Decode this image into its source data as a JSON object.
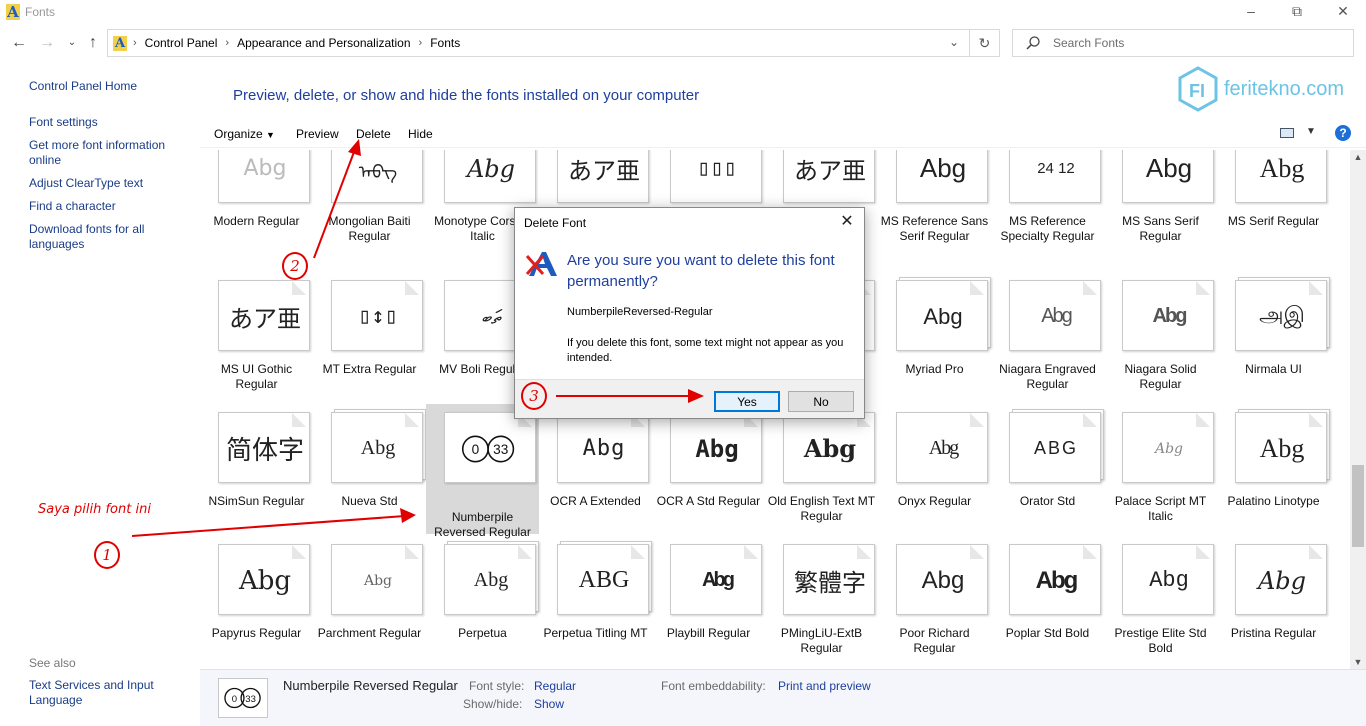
{
  "window": {
    "title": "Fonts",
    "app_icon_letter": "A"
  },
  "address_bar": {
    "crumbs": [
      "Control Panel",
      "Appearance and Personalization",
      "Fonts"
    ]
  },
  "search": {
    "placeholder": "Search Fonts"
  },
  "left_pane": {
    "links": [
      "Control Panel Home",
      "Font settings",
      "Get more font information online",
      "Adjust ClearType text",
      "Find a character",
      "Download fonts for all languages"
    ],
    "see_also_label": "See also",
    "see_also_links": [
      "Text Services and Input Language"
    ]
  },
  "header": {
    "heading": "Preview, delete, or show and hide the fonts installed on your computer"
  },
  "watermark": {
    "text": "feritekno.com"
  },
  "toolbar": {
    "organize": "Organize",
    "preview": "Preview",
    "delete": "Delete",
    "hide": "Hide",
    "help": "?"
  },
  "fonts": [
    {
      "name": "Modern Regular",
      "sample": "Abg",
      "stack": false
    },
    {
      "name": "Mongolian Baiti Regular",
      "sample": "ᠠᠪᠭ",
      "stack": false
    },
    {
      "name": "Monotype Corsiva Italic",
      "sample": "Abg",
      "stack": false
    },
    {
      "name": "",
      "sample": "あア亜",
      "stack": false
    },
    {
      "name": "",
      "sample": "▯▯▯",
      "stack": false
    },
    {
      "name": "",
      "sample": "あア亜",
      "stack": false
    },
    {
      "name": "MS Reference Sans Serif Regular",
      "sample": "Abg",
      "stack": false
    },
    {
      "name": "MS Reference Specialty Regular",
      "sample": "24 12",
      "stack": false
    },
    {
      "name": "MS Sans Serif Regular",
      "sample": "Abg",
      "stack": false
    },
    {
      "name": "MS Serif Regular",
      "sample": "Abg",
      "stack": false
    },
    {
      "name": "MS UI Gothic Regular",
      "sample": "あア亜",
      "stack": false
    },
    {
      "name": "MT Extra Regular",
      "sample": "▯↕▯",
      "stack": false
    },
    {
      "name": "MV Boli Regular",
      "sample": "ތަބ",
      "stack": false
    },
    {
      "name": "",
      "sample": "",
      "stack": false
    },
    {
      "name": "",
      "sample": "",
      "stack": false
    },
    {
      "name": "",
      "sample": "",
      "stack": false
    },
    {
      "name": "Myriad Pro",
      "sample": "Abg",
      "stack": true
    },
    {
      "name": "Niagara Engraved Regular",
      "sample": "Abg",
      "stack": false
    },
    {
      "name": "Niagara Solid Regular",
      "sample": "Abg",
      "stack": false
    },
    {
      "name": "Nirmala UI",
      "sample": "அஇ",
      "stack": true
    },
    {
      "name": "NSimSun Regular",
      "sample": "简体字",
      "stack": false
    },
    {
      "name": "Nueva Std",
      "sample": "Abg",
      "stack": true
    },
    {
      "name": "Numberpile Reversed Regular",
      "sample": "0 33",
      "stack": false
    },
    {
      "name": "OCR A Extended",
      "sample": "Abg",
      "stack": false
    },
    {
      "name": "OCR A Std Regular",
      "sample": "Abg",
      "stack": false
    },
    {
      "name": "Old English Text MT Regular",
      "sample": "Abg",
      "stack": false
    },
    {
      "name": "Onyx Regular",
      "sample": "Abg",
      "stack": false
    },
    {
      "name": "Orator Std",
      "sample": "ABG",
      "stack": true
    },
    {
      "name": "Palace Script MT Italic",
      "sample": "Abg",
      "stack": false
    },
    {
      "name": "Palatino Linotype",
      "sample": "Abg",
      "stack": true
    },
    {
      "name": "Papyrus Regular",
      "sample": "Abg",
      "stack": false
    },
    {
      "name": "Parchment Regular",
      "sample": "Abg",
      "stack": false
    },
    {
      "name": "Perpetua",
      "sample": "Abg",
      "stack": true
    },
    {
      "name": "Perpetua Titling MT",
      "sample": "ABG",
      "stack": true
    },
    {
      "name": "Playbill Regular",
      "sample": "Abg",
      "stack": false
    },
    {
      "name": "PMingLiU-ExtB Regular",
      "sample": "繁體字",
      "stack": false
    },
    {
      "name": "Poor Richard Regular",
      "sample": "Abg",
      "stack": false
    },
    {
      "name": "Poplar Std Bold",
      "sample": "Abg",
      "stack": false
    },
    {
      "name": "Prestige Elite Std Bold",
      "sample": "Abg",
      "stack": false
    },
    {
      "name": "Pristina Regular",
      "sample": "Abg",
      "stack": false
    }
  ],
  "selected_index": 22,
  "details": {
    "font_name": "Numberpile Reversed Regular",
    "thumb_sample": "0 33",
    "font_style_label": "Font style:",
    "font_style_value": "Regular",
    "show_hide_label": "Show/hide:",
    "show_hide_value": "Show",
    "embed_label": "Font embeddability:",
    "embed_value": "Print and preview"
  },
  "dialog": {
    "title": "Delete Font",
    "question": "Are you sure you want to delete this font permanently?",
    "font_name": "NumberpileReversed-Regular",
    "warning": "If you delete this font, some text might not appear as you intended.",
    "yes": "Yes",
    "no": "No"
  },
  "annotations": {
    "caption": "Saya pilih font ini",
    "step1": "1",
    "step2": "2",
    "step3": "3",
    "color": "#e10000"
  }
}
